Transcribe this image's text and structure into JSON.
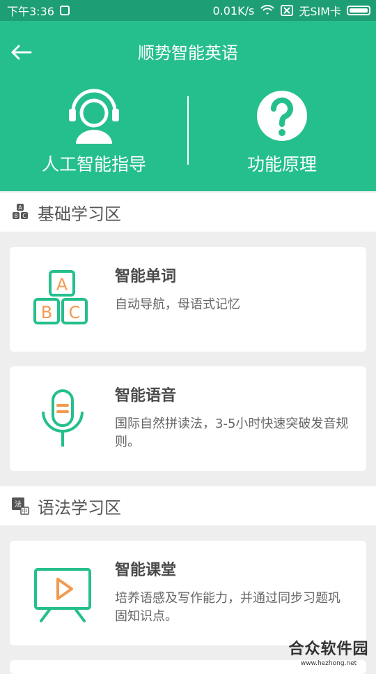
{
  "status_bar": {
    "time": "下午3:36",
    "network_speed": "0.01K/s",
    "sim": "无SIM卡"
  },
  "header": {
    "title": "顺势智能英语",
    "features": [
      {
        "label": "人工智能指导",
        "icon": "headset-person-icon"
      },
      {
        "label": "功能原理",
        "icon": "question-icon"
      }
    ]
  },
  "sections": [
    {
      "title": "基础学习区",
      "icon": "abc-icon",
      "cards": [
        {
          "title": "智能单词",
          "desc": "自动导航，母语式记忆",
          "icon": "abc-blocks-icon"
        },
        {
          "title": "智能语音",
          "desc": "国际自然拼读法，3-5小时快速突破发音规则。",
          "icon": "microphone-icon"
        }
      ]
    },
    {
      "title": "语法学习区",
      "icon": "grammar-icon",
      "cards": [
        {
          "title": "智能课堂",
          "desc": "培养语感及写作能力，并通过同步习题巩固知识点。",
          "icon": "video-board-icon"
        }
      ]
    }
  ],
  "watermark": {
    "main": "合众软件园",
    "sub": "www.hezhong.net"
  },
  "colors": {
    "brand_green": "#25bf8d",
    "accent_orange": "#f39a51"
  }
}
